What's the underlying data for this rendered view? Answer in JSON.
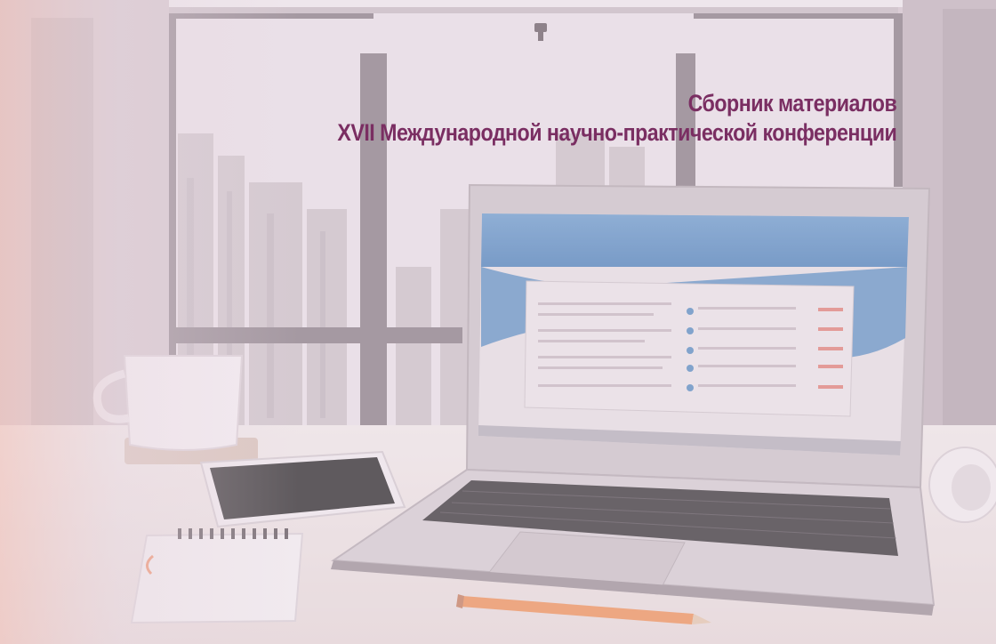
{
  "title": {
    "line1": "Сборник материалов",
    "line2": "XVII Международной научно-практической конференции"
  },
  "colors": {
    "title_text": "#7a2e62",
    "tint_overlay": "#e7d6e2",
    "laptop_screen_blue": "#5b8fc4",
    "desk": "#efe6e6",
    "pencil": "#f0955e"
  },
  "icons": [
    "coffee-cup-icon",
    "tablet-icon",
    "notepad-icon",
    "laptop-icon",
    "pencil-icon",
    "headphones-icon",
    "ceiling-lamp-icon"
  ]
}
